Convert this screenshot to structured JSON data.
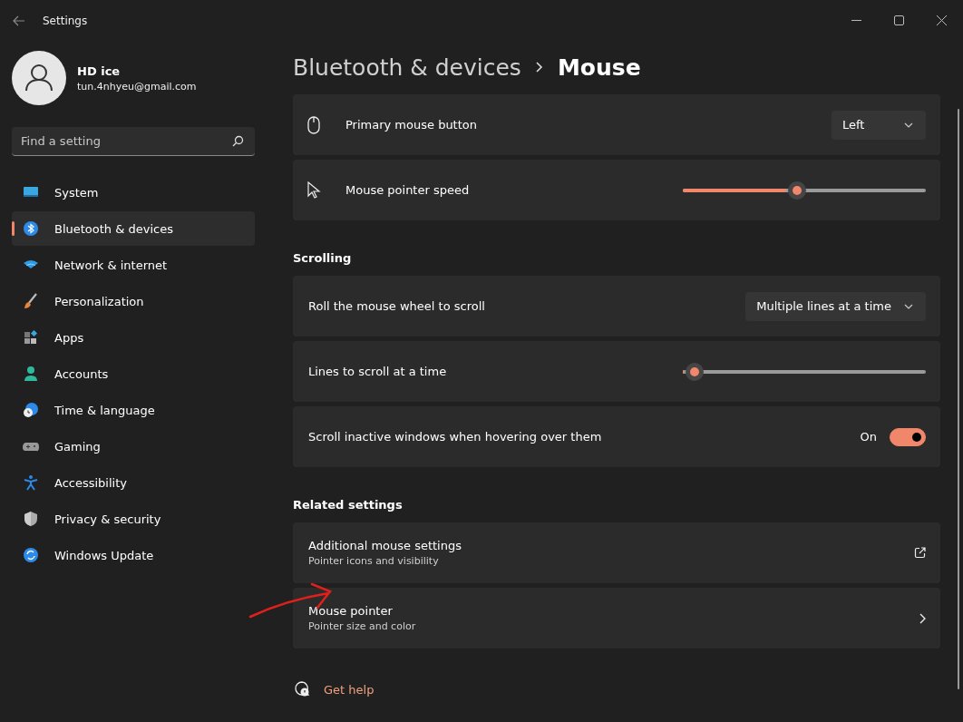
{
  "window": {
    "title": "Settings"
  },
  "account": {
    "name": "HD ice",
    "email": "tun.4nhyeu@gmail.com"
  },
  "search": {
    "placeholder": "Find a setting"
  },
  "nav": [
    {
      "kind": "system",
      "label": "System",
      "selected": false
    },
    {
      "kind": "bluetooth",
      "label": "Bluetooth & devices",
      "selected": true
    },
    {
      "kind": "network",
      "label": "Network & internet",
      "selected": false
    },
    {
      "kind": "brush",
      "label": "Personalization",
      "selected": false
    },
    {
      "kind": "apps",
      "label": "Apps",
      "selected": false
    },
    {
      "kind": "person",
      "label": "Accounts",
      "selected": false
    },
    {
      "kind": "globe",
      "label": "Time & language",
      "selected": false
    },
    {
      "kind": "gamepad",
      "label": "Gaming",
      "selected": false
    },
    {
      "kind": "accessibility",
      "label": "Accessibility",
      "selected": false
    },
    {
      "kind": "shield",
      "label": "Privacy & security",
      "selected": false
    },
    {
      "kind": "update",
      "label": "Windows Update",
      "selected": false
    }
  ],
  "breadcrumb": {
    "parent": "Bluetooth & devices",
    "current": "Mouse"
  },
  "sections": [
    {
      "rows": [
        {
          "kind": "dropdown",
          "label": "Primary mouse button",
          "value": "Left"
        },
        {
          "kind": "slider",
          "label": "Mouse pointer speed",
          "level": 0.47
        }
      ]
    },
    {
      "heading": "Scrolling",
      "rows": [
        {
          "kind": "dropdown",
          "label": "Roll the mouse wheel to scroll",
          "value": "Multiple lines at a time"
        },
        {
          "kind": "slider",
          "label": "Lines to scroll at a time",
          "level": 0.05
        },
        {
          "kind": "toggle",
          "label": "Scroll inactive windows when hovering over them",
          "on": true,
          "state_label": "On"
        }
      ]
    },
    {
      "heading": "Related settings",
      "rows": [
        {
          "kind": "external",
          "label": "Additional mouse settings",
          "subtitle": "Pointer icons and visibility"
        },
        {
          "kind": "chevron",
          "label": "Mouse pointer",
          "subtitle": "Pointer size and color"
        }
      ]
    }
  ],
  "help": {
    "label": "Get help"
  }
}
